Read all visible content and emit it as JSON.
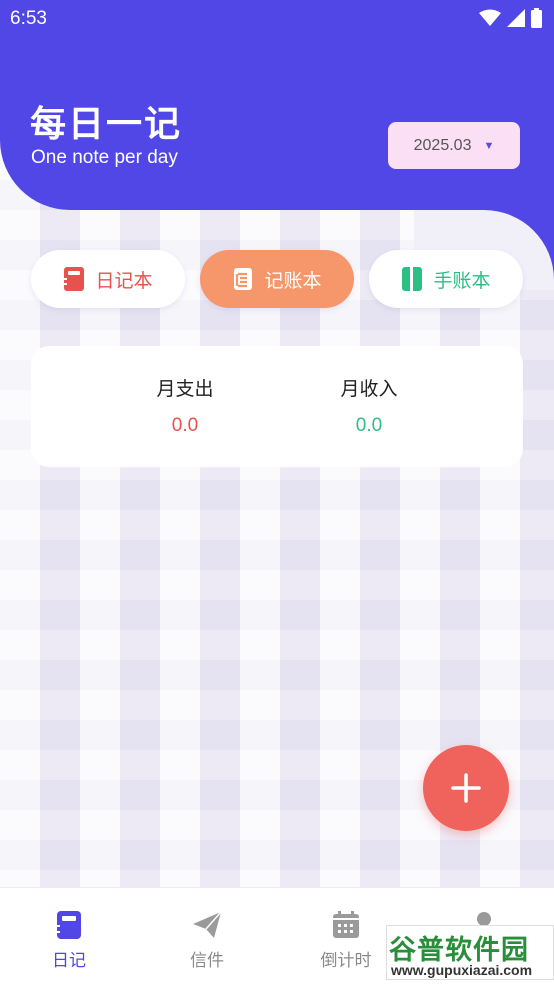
{
  "status_bar": {
    "time": "6:53"
  },
  "header": {
    "title": "每日一记",
    "subtitle": "One note per day",
    "month_picker": {
      "value": "2025.03"
    }
  },
  "tabs": [
    {
      "label": "日记本",
      "color": "#e8524e",
      "active": false
    },
    {
      "label": "记账本",
      "color": "#f6976b",
      "active": true
    },
    {
      "label": "手账本",
      "color": "#2bbf86",
      "active": false
    }
  ],
  "summary": {
    "expense": {
      "label": "月支出",
      "value": "0.0"
    },
    "income": {
      "label": "月收入",
      "value": "0.0"
    }
  },
  "fab": {
    "icon": "plus-icon"
  },
  "bottom_nav": [
    {
      "label": "日记",
      "icon": "notebook-icon",
      "active": true
    },
    {
      "label": "信件",
      "icon": "paper-plane-icon",
      "active": false
    },
    {
      "label": "倒计时",
      "icon": "calendar-icon",
      "active": false
    },
    {
      "label": "",
      "icon": "person-icon",
      "active": false
    }
  ],
  "watermark": {
    "title": "谷普软件园",
    "url": "www.gupuxiazai.com"
  },
  "colors": {
    "primary": "#5147e6",
    "accent": "#f0625c",
    "expense": "#e8524e",
    "income": "#2bbf86"
  }
}
